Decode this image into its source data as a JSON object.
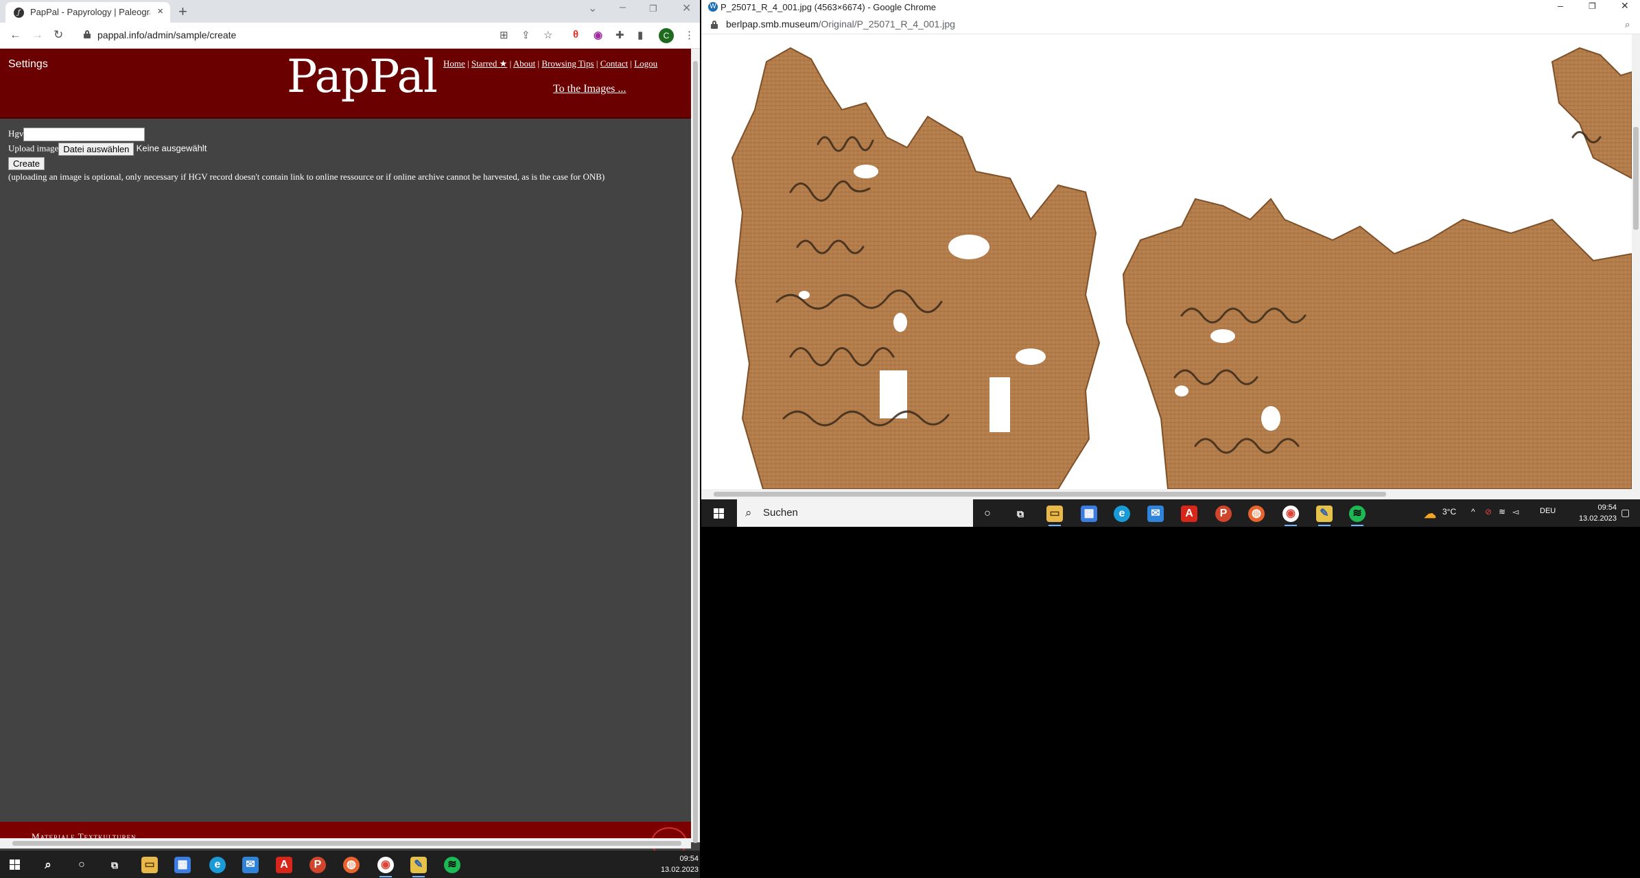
{
  "left_browser": {
    "tab_title": "PapPal - Papyrology | Paleograph",
    "url": "pappal.info/admin/sample/create",
    "profile_initial": "C"
  },
  "site": {
    "settings_label": "Settings",
    "logo": "PapPal",
    "nav": [
      "Home",
      "Starred ★",
      "About",
      "Browsing Tips",
      "Contact",
      "Logou"
    ],
    "to_images": "To the Images ...",
    "footer_text": "Materiale Textkulturen"
  },
  "form": {
    "hgv_label": "Hgv",
    "hgv_value": "",
    "upload_label": "Upload image",
    "file_button": "Datei auswählen",
    "file_status": "Keine ausgewählt",
    "create_button": "Create",
    "hint": "(uploading an image is optional, only necessary if HGV record doesn't contain link to online ressource or if online archive cannot be harvested, as is the case for ONB)"
  },
  "right_browser": {
    "window_title": "P_25071_R_4_001.jpg (4563×6674) - Google Chrome",
    "url_host": "berlpap.smb.museum",
    "url_path": "/Original/P_25071_R_4_001.jpg",
    "image_alt": "papyrus-fragment"
  },
  "right_taskbar": {
    "search_placeholder": "Suchen",
    "weather": "3°C",
    "language": "DEU",
    "time": "09:54",
    "date": "13.02.2023"
  },
  "bottom_taskbar": {
    "time": "09:54",
    "date": "13.02.2023"
  },
  "colors": {
    "site_header": "#6b0000",
    "page_bg": "#434343",
    "papyrus": "#b07a4a"
  }
}
